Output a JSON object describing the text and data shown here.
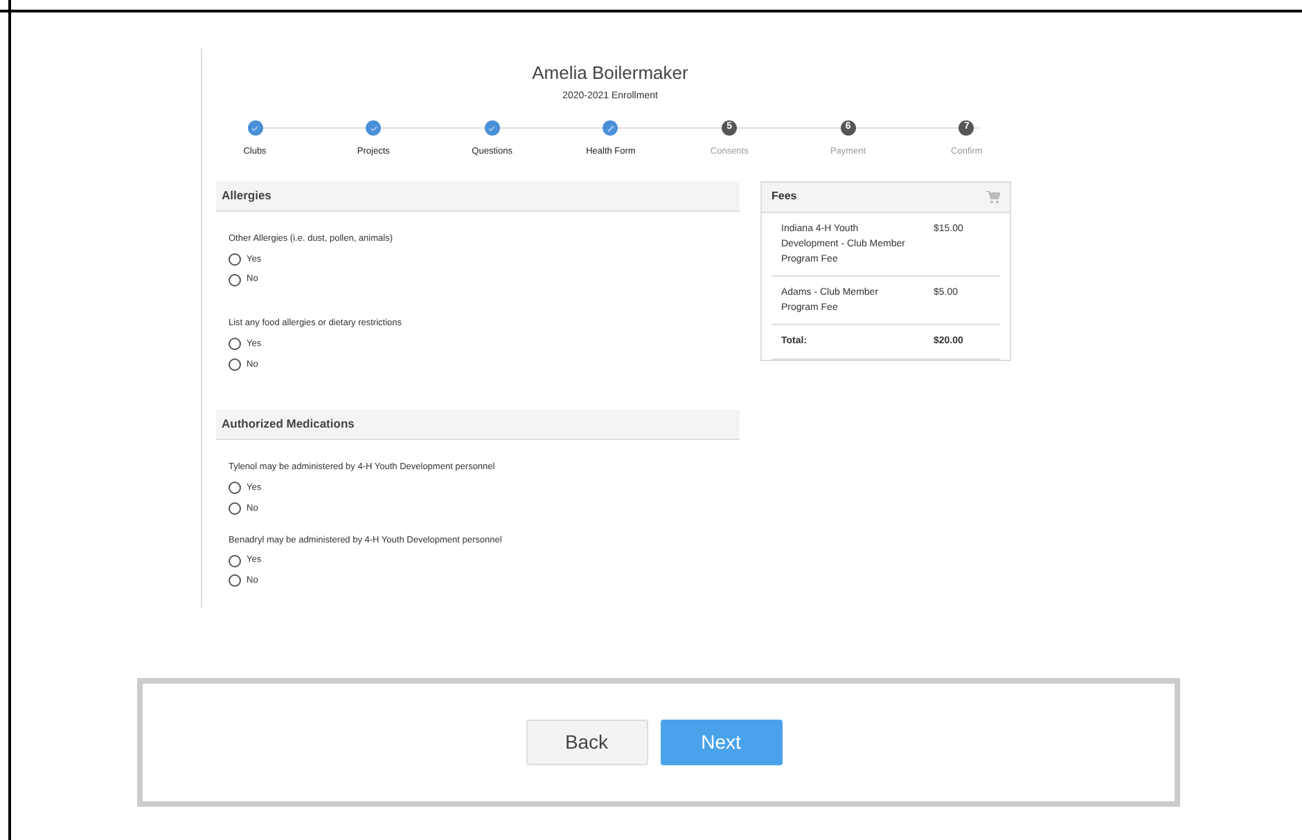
{
  "header": {
    "name": "Amelia Boilermaker",
    "subtitle": "2020-2021 Enrollment"
  },
  "steps": [
    {
      "label": "Clubs",
      "kind": "done"
    },
    {
      "label": "Projects",
      "kind": "done"
    },
    {
      "label": "Questions",
      "kind": "done"
    },
    {
      "label": "Health Form",
      "kind": "current"
    },
    {
      "label": "Consents",
      "kind": "pending",
      "number": "5"
    },
    {
      "label": "Payment",
      "kind": "pending",
      "number": "6"
    },
    {
      "label": "Confirm",
      "kind": "pending",
      "number": "7"
    }
  ],
  "sections": [
    {
      "title": "Allergies",
      "questions": [
        {
          "prompt": "Other Allergies (i.e. dust, pollen, animals)",
          "options": [
            {
              "label": "Yes",
              "selected": false
            },
            {
              "label": "No",
              "selected": false
            }
          ]
        },
        {
          "prompt": "List any food allergies or dietary restrictions",
          "options": [
            {
              "label": "Yes",
              "selected": false
            },
            {
              "label": "No",
              "selected": false
            }
          ]
        }
      ]
    },
    {
      "title": "Authorized Medications",
      "questions": [
        {
          "prompt": "Tylenol may be administered by 4-H Youth Development personnel",
          "options": [
            {
              "label": "Yes",
              "selected": false
            },
            {
              "label": "No",
              "selected": false
            }
          ]
        },
        {
          "prompt": "Benadryl may be administered by 4-H Youth Development personnel",
          "options": [
            {
              "label": "Yes",
              "selected": false
            },
            {
              "label": "No",
              "selected": false
            }
          ]
        }
      ]
    }
  ],
  "fees": {
    "title": "Fees",
    "items": [
      {
        "name": "Indiana 4-H Youth Development - Club Member Program Fee",
        "amount": "$15.00"
      },
      {
        "name": "Adams - Club Member Program Fee",
        "amount": "$5.00"
      }
    ],
    "total_label": "Total:",
    "total": "$20.00"
  },
  "buttons": [
    {
      "label": "Back",
      "kind": "secondary"
    },
    {
      "label": "Next",
      "kind": "primary"
    }
  ]
}
